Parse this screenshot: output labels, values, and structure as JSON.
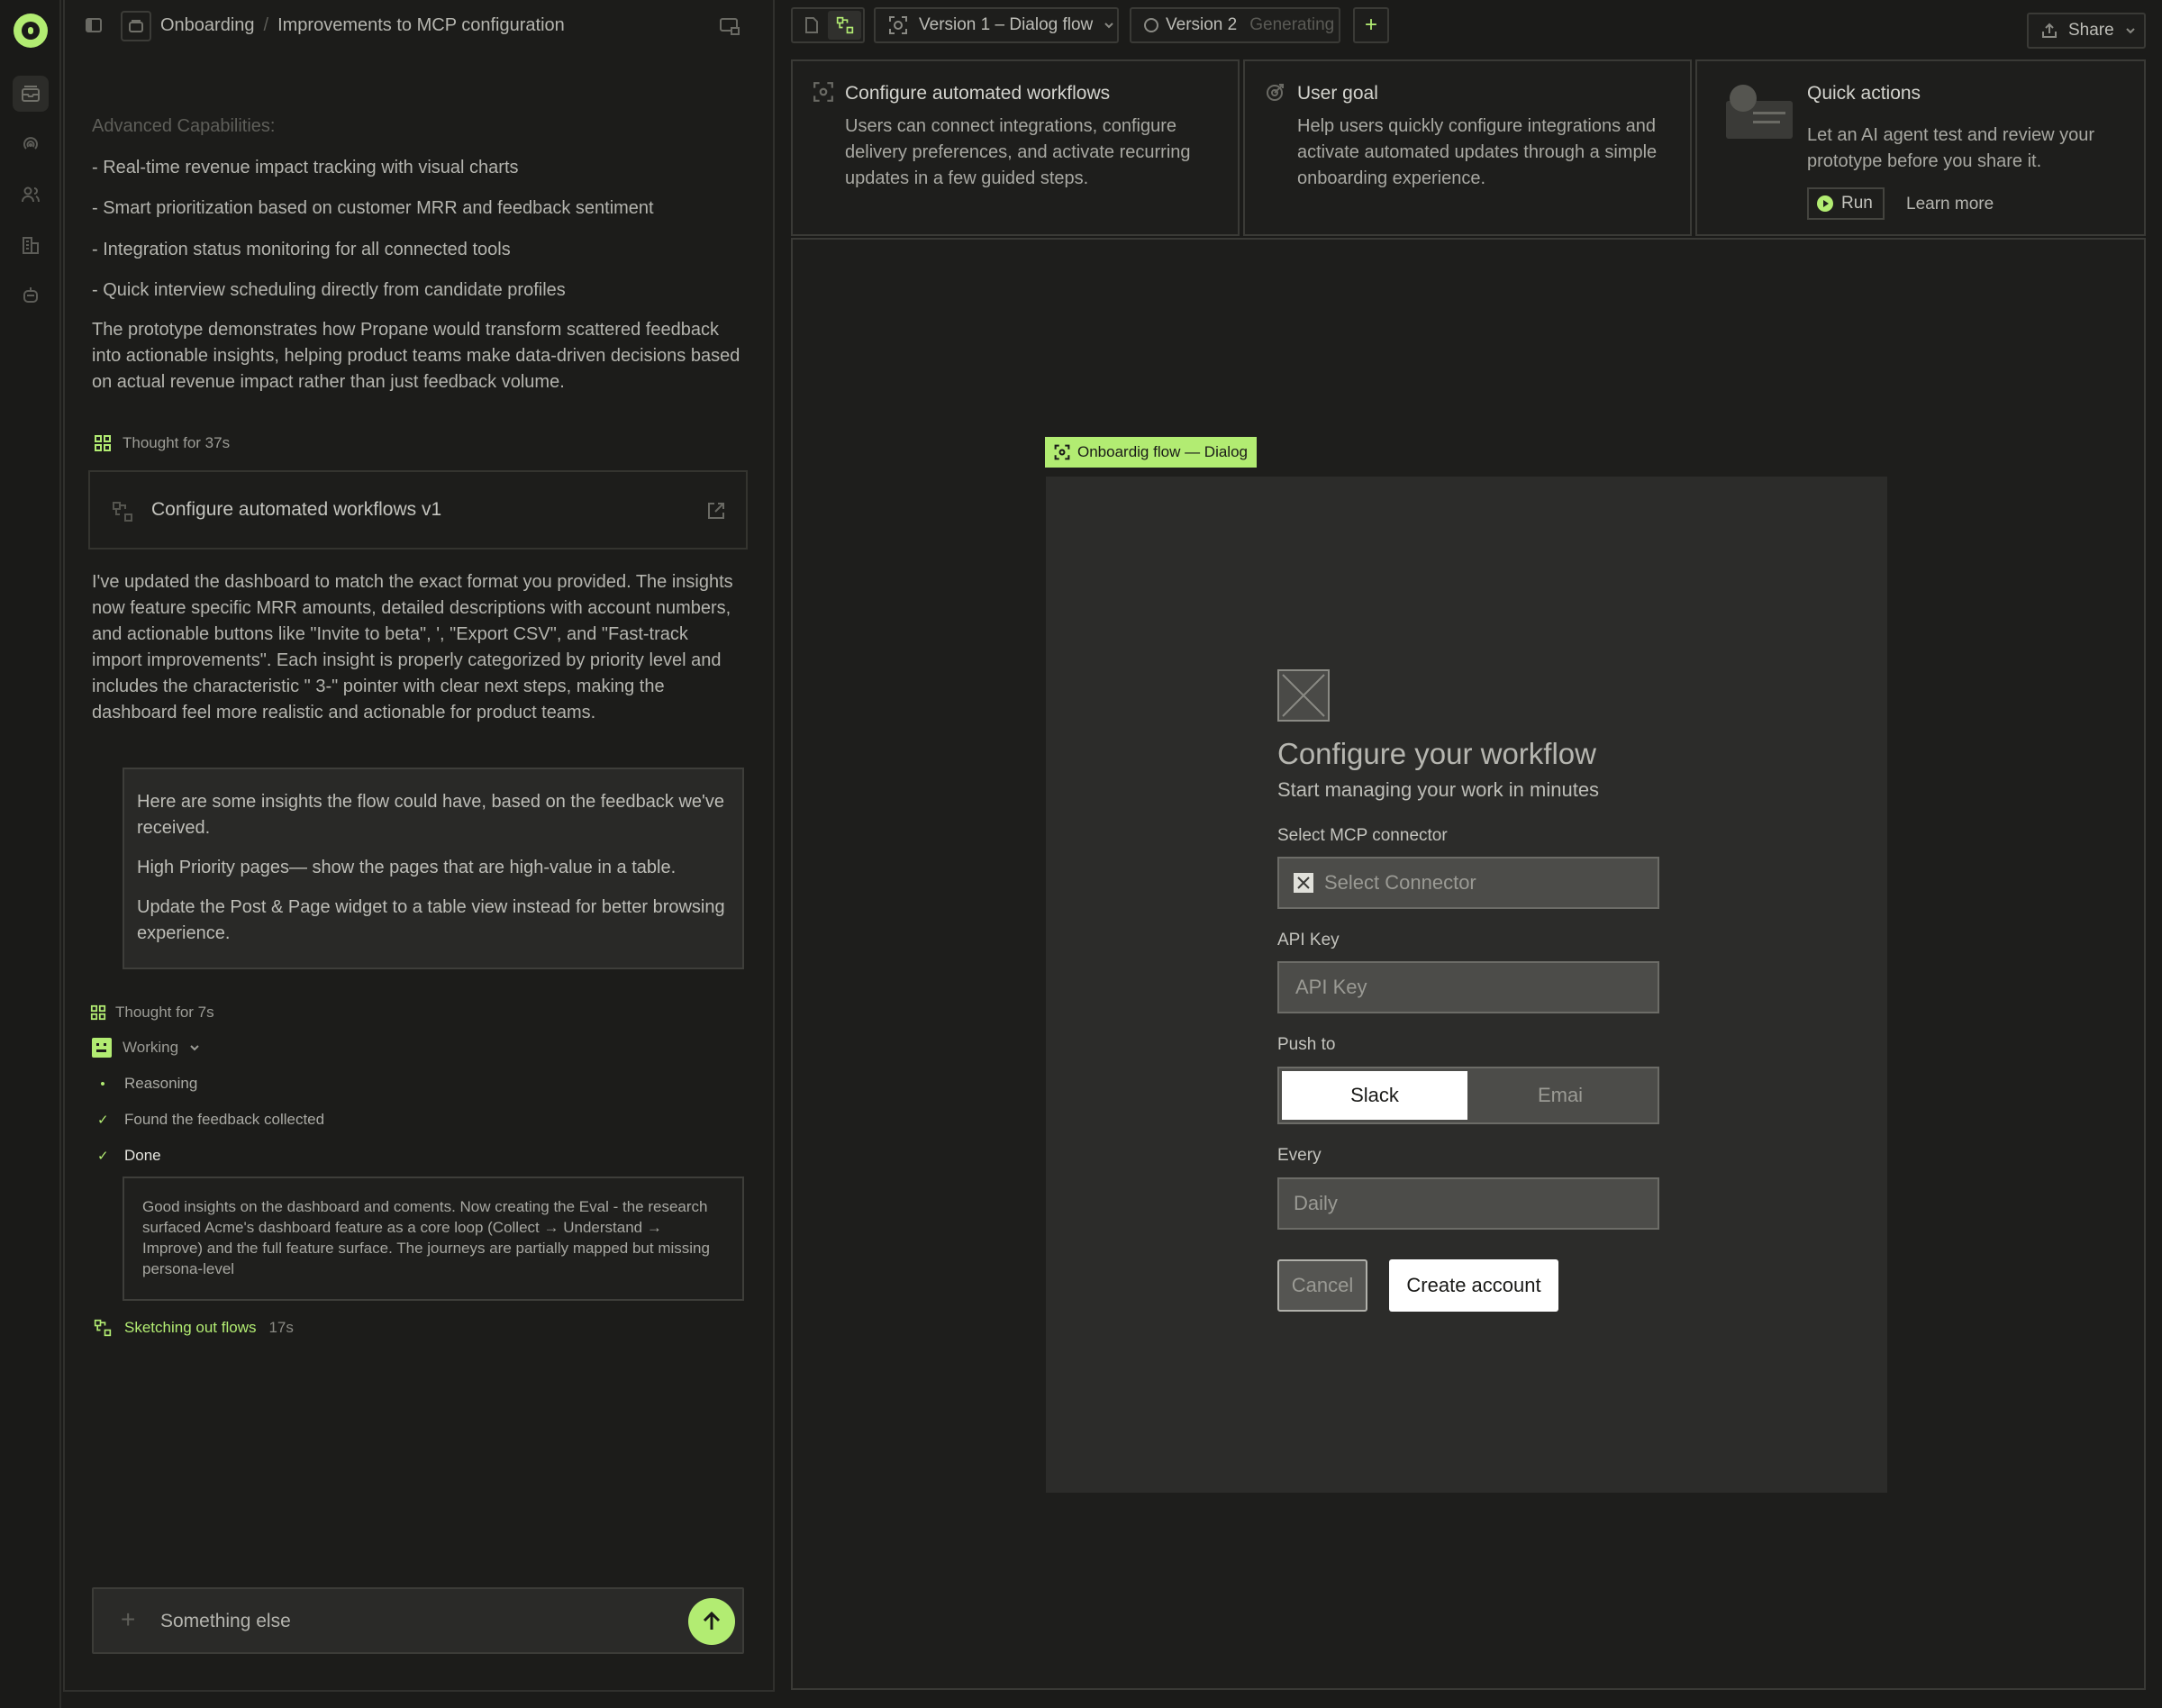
{
  "breadcrumb": {
    "root": "Onboarding",
    "separator": "/",
    "page": "Improvements to MCP configuration"
  },
  "chat": {
    "capabilities_heading": "Advanced Capabilities:",
    "capabilities": [
      "- Real-time revenue impact tracking with visual charts",
      "- Smart prioritization based on customer MRR and feedback sentiment",
      "- Integration status monitoring for all connected tools",
      "- Quick interview scheduling directly from candidate profiles"
    ],
    "summary": "The prototype demonstrates how Propane would transform scattered feedback into actionable insights, helping product teams make data-driven decisions based on actual revenue impact rather than just feedback volume.",
    "thought_1": "Thought for 37s",
    "artifact_label": "Configure automated workflows  v1",
    "update_message": "I've updated the dashboard to match the exact format you provided. The insights now feature specific MRR amounts, detailed descriptions with account numbers, and actionable buttons like \"Invite to beta\", ', \"Export CSV\", and \"Fast-track import improvements\". Each insight is properly categorized by priority level and includes the characteristic \" 3-\" pointer with clear next steps, making the dashboard feel more realistic and actionable for product teams.",
    "user_quote": [
      "Here are some insights the flow could have, based on the feedback we've received.",
      "High Priority pages— show the pages that are high-value in a table.",
      "Update the Post & Page widget to a table view instead for better browsing experience."
    ],
    "thought_2": "Thought for 7s",
    "working_label": "Working",
    "steps": [
      {
        "mark": "•",
        "label": "Reasoning"
      },
      {
        "mark": "✓",
        "label": "Found the feedback collected"
      },
      {
        "mark": "✓",
        "label": "Done"
      }
    ],
    "insight_note": "Good insights on the dashboard and coments. Now creating the Eval - the research surfaced Acme's dashboard feature as a core loop (Collect → Understand → Improve) and the full feature surface. The journeys are partially mapped but missing persona-level",
    "sketching_label": "Sketching out flows",
    "sketching_time": "17s",
    "input_placeholder": "Something else"
  },
  "toolbar": {
    "version1_label": "Version 1 – Dialog flow",
    "version2_label": "Version 2",
    "version2_status": "Generating",
    "add_label": "+",
    "share_label": "Share"
  },
  "cards": {
    "workflows": {
      "title": "Configure automated workflows",
      "desc": "Users can connect integrations, configure delivery preferences, and activate recurring updates in a few guided steps."
    },
    "goal": {
      "title": "User goal",
      "desc": "Help users quickly configure integrations and activate automated updates through a simple onboarding experience."
    },
    "quick": {
      "title": "Quick actions",
      "desc": "Let an AI agent test and review your prototype before you share it.",
      "run_label": "Run",
      "learn_label": "Learn more"
    }
  },
  "frame_tag": "Onboardig flow — Dialog",
  "dialog": {
    "title": "Configure your workflow",
    "subtitle": "Start managing your work in minutes",
    "connector_label": "Select MCP connector",
    "connector_placeholder": "Select Connector",
    "api_label": "API Key",
    "api_placeholder": "API Key",
    "push_label": "Push to",
    "push_options": [
      "Slack",
      "Emai"
    ],
    "push_selected": "Slack",
    "every_label": "Every",
    "every_value": "Daily",
    "cancel_label": "Cancel",
    "create_label": "Create account"
  },
  "colors": {
    "accent": "#b2ec72",
    "background": "#1b1b19"
  },
  "icons": [
    "app-logo-icon",
    "sidebar-toggle-icon",
    "inbox-icon",
    "signal-icon",
    "users-icon",
    "building-icon",
    "bot-icon",
    "screen-share-icon",
    "document-icon",
    "flow-icon",
    "focus-icon",
    "target-icon",
    "external-link-icon",
    "arrow-up-icon",
    "play-icon",
    "chevron-down-icon"
  ]
}
